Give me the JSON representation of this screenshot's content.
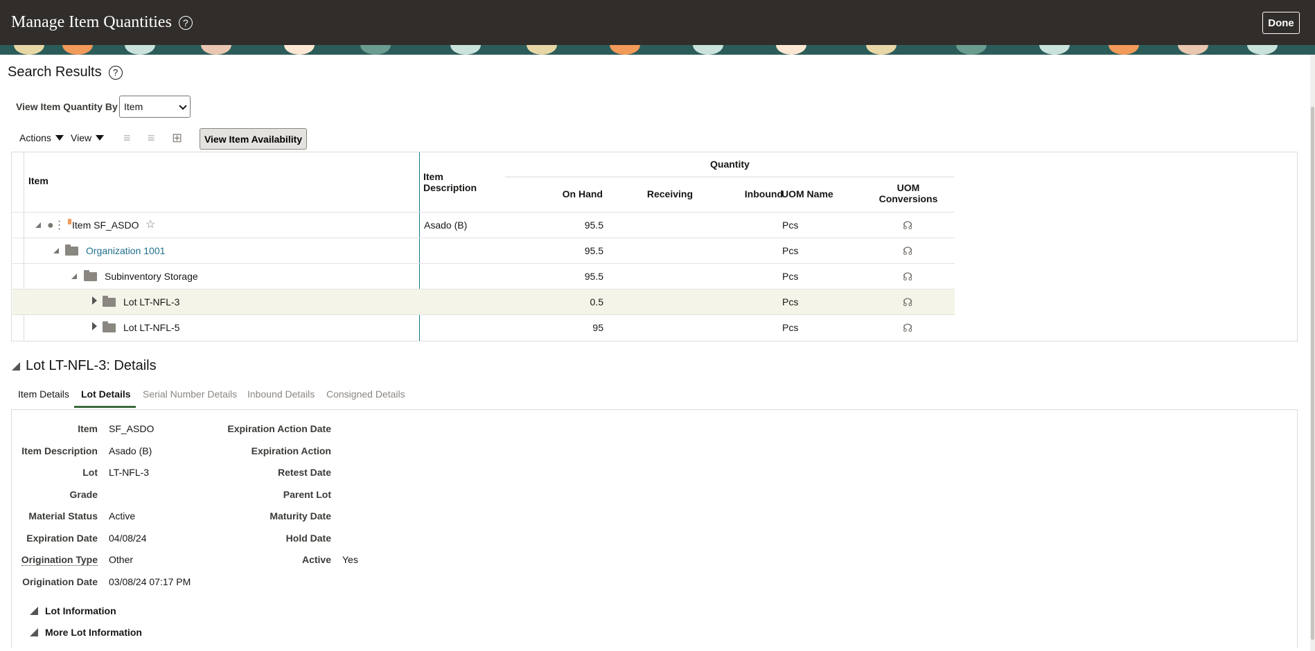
{
  "header": {
    "title": "Manage Item Quantities",
    "done_label": "Done"
  },
  "search_results": {
    "title": "Search Results",
    "view_by_label": "View Item Quantity By",
    "view_by_value": "Item",
    "actions_label": "Actions",
    "view_label": "View",
    "view_availability_label": "View Item Availability"
  },
  "grid": {
    "headers": {
      "item": "Item",
      "item_description": "Item Description",
      "quantity": "Quantity",
      "on_hand": "On Hand",
      "receiving": "Receiving",
      "inbound": "Inbound",
      "uom_name": "UOM Name",
      "uom_conversions": "UOM Conversions"
    },
    "rows": [
      {
        "label": "Item SF_ASDO",
        "description": "Asado (B)",
        "on_hand": "95.5",
        "uom": "Pcs"
      },
      {
        "label": "Organization 1001",
        "description": "",
        "on_hand": "95.5",
        "uom": "Pcs"
      },
      {
        "label": "Subinventory Storage",
        "description": "",
        "on_hand": "95.5",
        "uom": "Pcs"
      },
      {
        "label": "Lot LT-NFL-3",
        "description": "",
        "on_hand": "0.5",
        "uom": "Pcs"
      },
      {
        "label": "Lot LT-NFL-5",
        "description": "",
        "on_hand": "95",
        "uom": "Pcs"
      }
    ]
  },
  "details": {
    "title": "Lot LT-NFL-3: Details",
    "tabs": [
      "Item Details",
      "Lot Details",
      "Serial Number Details",
      "Inbound Details",
      "Consigned Details"
    ],
    "left_fields": [
      {
        "label": "Item",
        "value": "SF_ASDO"
      },
      {
        "label": "Item Description",
        "value": "Asado (B)"
      },
      {
        "label": "Lot",
        "value": "LT-NFL-3"
      },
      {
        "label": "Grade",
        "value": ""
      },
      {
        "label": "Material Status",
        "value": "Active"
      },
      {
        "label": "Expiration Date",
        "value": "04/08/24"
      },
      {
        "label": "Origination Type",
        "value": "Other"
      },
      {
        "label": "Origination Date",
        "value": "03/08/24 07:17 PM"
      }
    ],
    "right_fields": [
      {
        "label": "Expiration Action Date",
        "value": ""
      },
      {
        "label": "Expiration Action",
        "value": ""
      },
      {
        "label": "Retest Date",
        "value": ""
      },
      {
        "label": "Parent Lot",
        "value": ""
      },
      {
        "label": "Maturity Date",
        "value": ""
      },
      {
        "label": "Hold Date",
        "value": ""
      },
      {
        "label": "Active",
        "value": "Yes"
      }
    ],
    "sections": [
      "Lot Information",
      "More Lot Information"
    ]
  }
}
